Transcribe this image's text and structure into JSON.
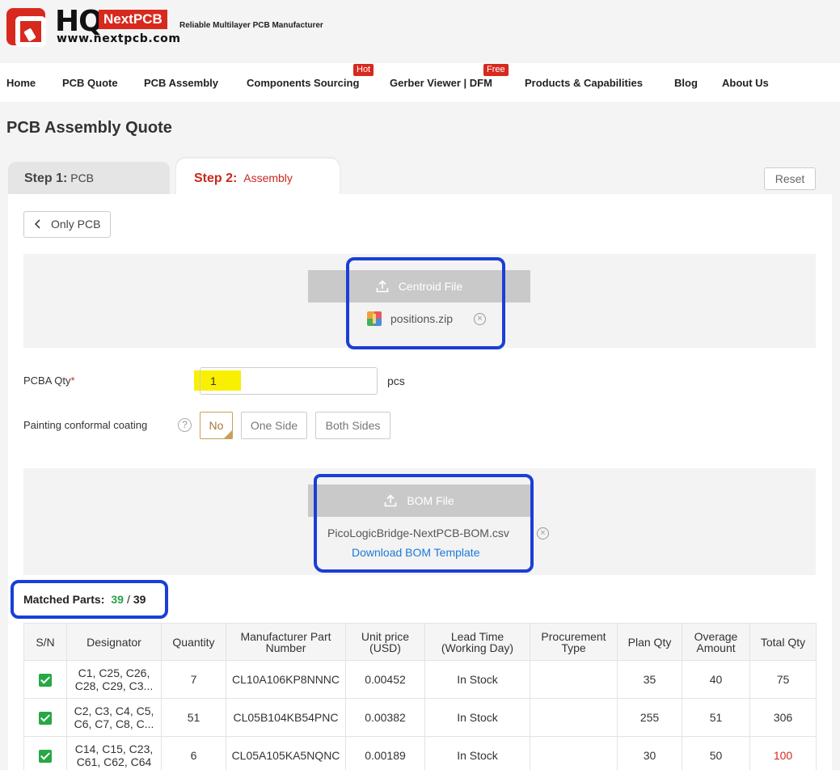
{
  "brand": {
    "logo_hq": "HQ",
    "logo_next": "NextPCB",
    "url": "www.nextpcb.com",
    "tagline": "Reliable Multilayer PCB Manufacturer",
    "color": "#d7291d"
  },
  "nav": {
    "items": [
      {
        "label": "Home"
      },
      {
        "label": "PCB Quote"
      },
      {
        "label": "PCB Assembly"
      },
      {
        "label": "Components Sourcing",
        "badge": "Hot"
      },
      {
        "label": "Gerber Viewer | DFM",
        "badge": "Free"
      },
      {
        "label": "Products & Capabilities"
      },
      {
        "label": "Blog"
      },
      {
        "label": "About Us"
      }
    ]
  },
  "page": {
    "title": "PCB Assembly Quote"
  },
  "tabs": [
    {
      "step": "Step 1:",
      "label": "PCB"
    },
    {
      "step": "Step 2:",
      "label": "Assembly"
    }
  ],
  "reset_label": "Reset",
  "only_pcb_label": "Only PCB",
  "centroid": {
    "button_label": "Centroid File",
    "file_name": "positions.zip"
  },
  "pcba_qty": {
    "label": "PCBA Qty",
    "required_mark": "*",
    "value": "1",
    "unit": "pcs"
  },
  "coating": {
    "label": "Painting conformal coating",
    "options": [
      "No",
      "One Side",
      "Both Sides"
    ],
    "selected": "No"
  },
  "bom": {
    "button_label": "BOM File",
    "file_name": "PicoLogicBridge-NextPCB-BOM.csv",
    "template_link": "Download BOM Template"
  },
  "matched": {
    "label": "Matched Parts:",
    "matched": "39",
    "separator": "/",
    "total": "39"
  },
  "table": {
    "headers": [
      "S/N",
      "Designator",
      "Quantity",
      "Manufacturer Part Number",
      "Unit price (USD)",
      "Lead Time (Working Day)",
      "Procurement Type",
      "Plan Qty",
      "Overage Amount",
      "Total Qty"
    ],
    "rows": [
      {
        "designator": "C1, C25, C26, C28, C29, C3...",
        "quantity": "7",
        "mpn": "CL10A106KP8NNNC",
        "price": "0.00452",
        "lead": "In Stock",
        "proc": "",
        "plan": "35",
        "overage": "40",
        "total": "75"
      },
      {
        "designator": "C2, C3, C4, C5, C6, C7, C8, C...",
        "quantity": "51",
        "mpn": "CL05B104KB54PNC",
        "price": "0.00382",
        "lead": "In Stock",
        "proc": "",
        "plan": "255",
        "overage": "51",
        "total": "306"
      },
      {
        "designator": "C14, C15, C23, C61, C62, C64",
        "quantity": "6",
        "mpn": "CL05A105KA5NQNC",
        "price": "0.00189",
        "lead": "In Stock",
        "proc": "",
        "plan": "30",
        "overage": "50",
        "total": "100"
      }
    ]
  },
  "colors": {
    "accent_red": "#d7291d",
    "annotation_blue": "#1a3fd6",
    "highlight_yellow": "#f8f000",
    "check_green": "#27a844"
  }
}
